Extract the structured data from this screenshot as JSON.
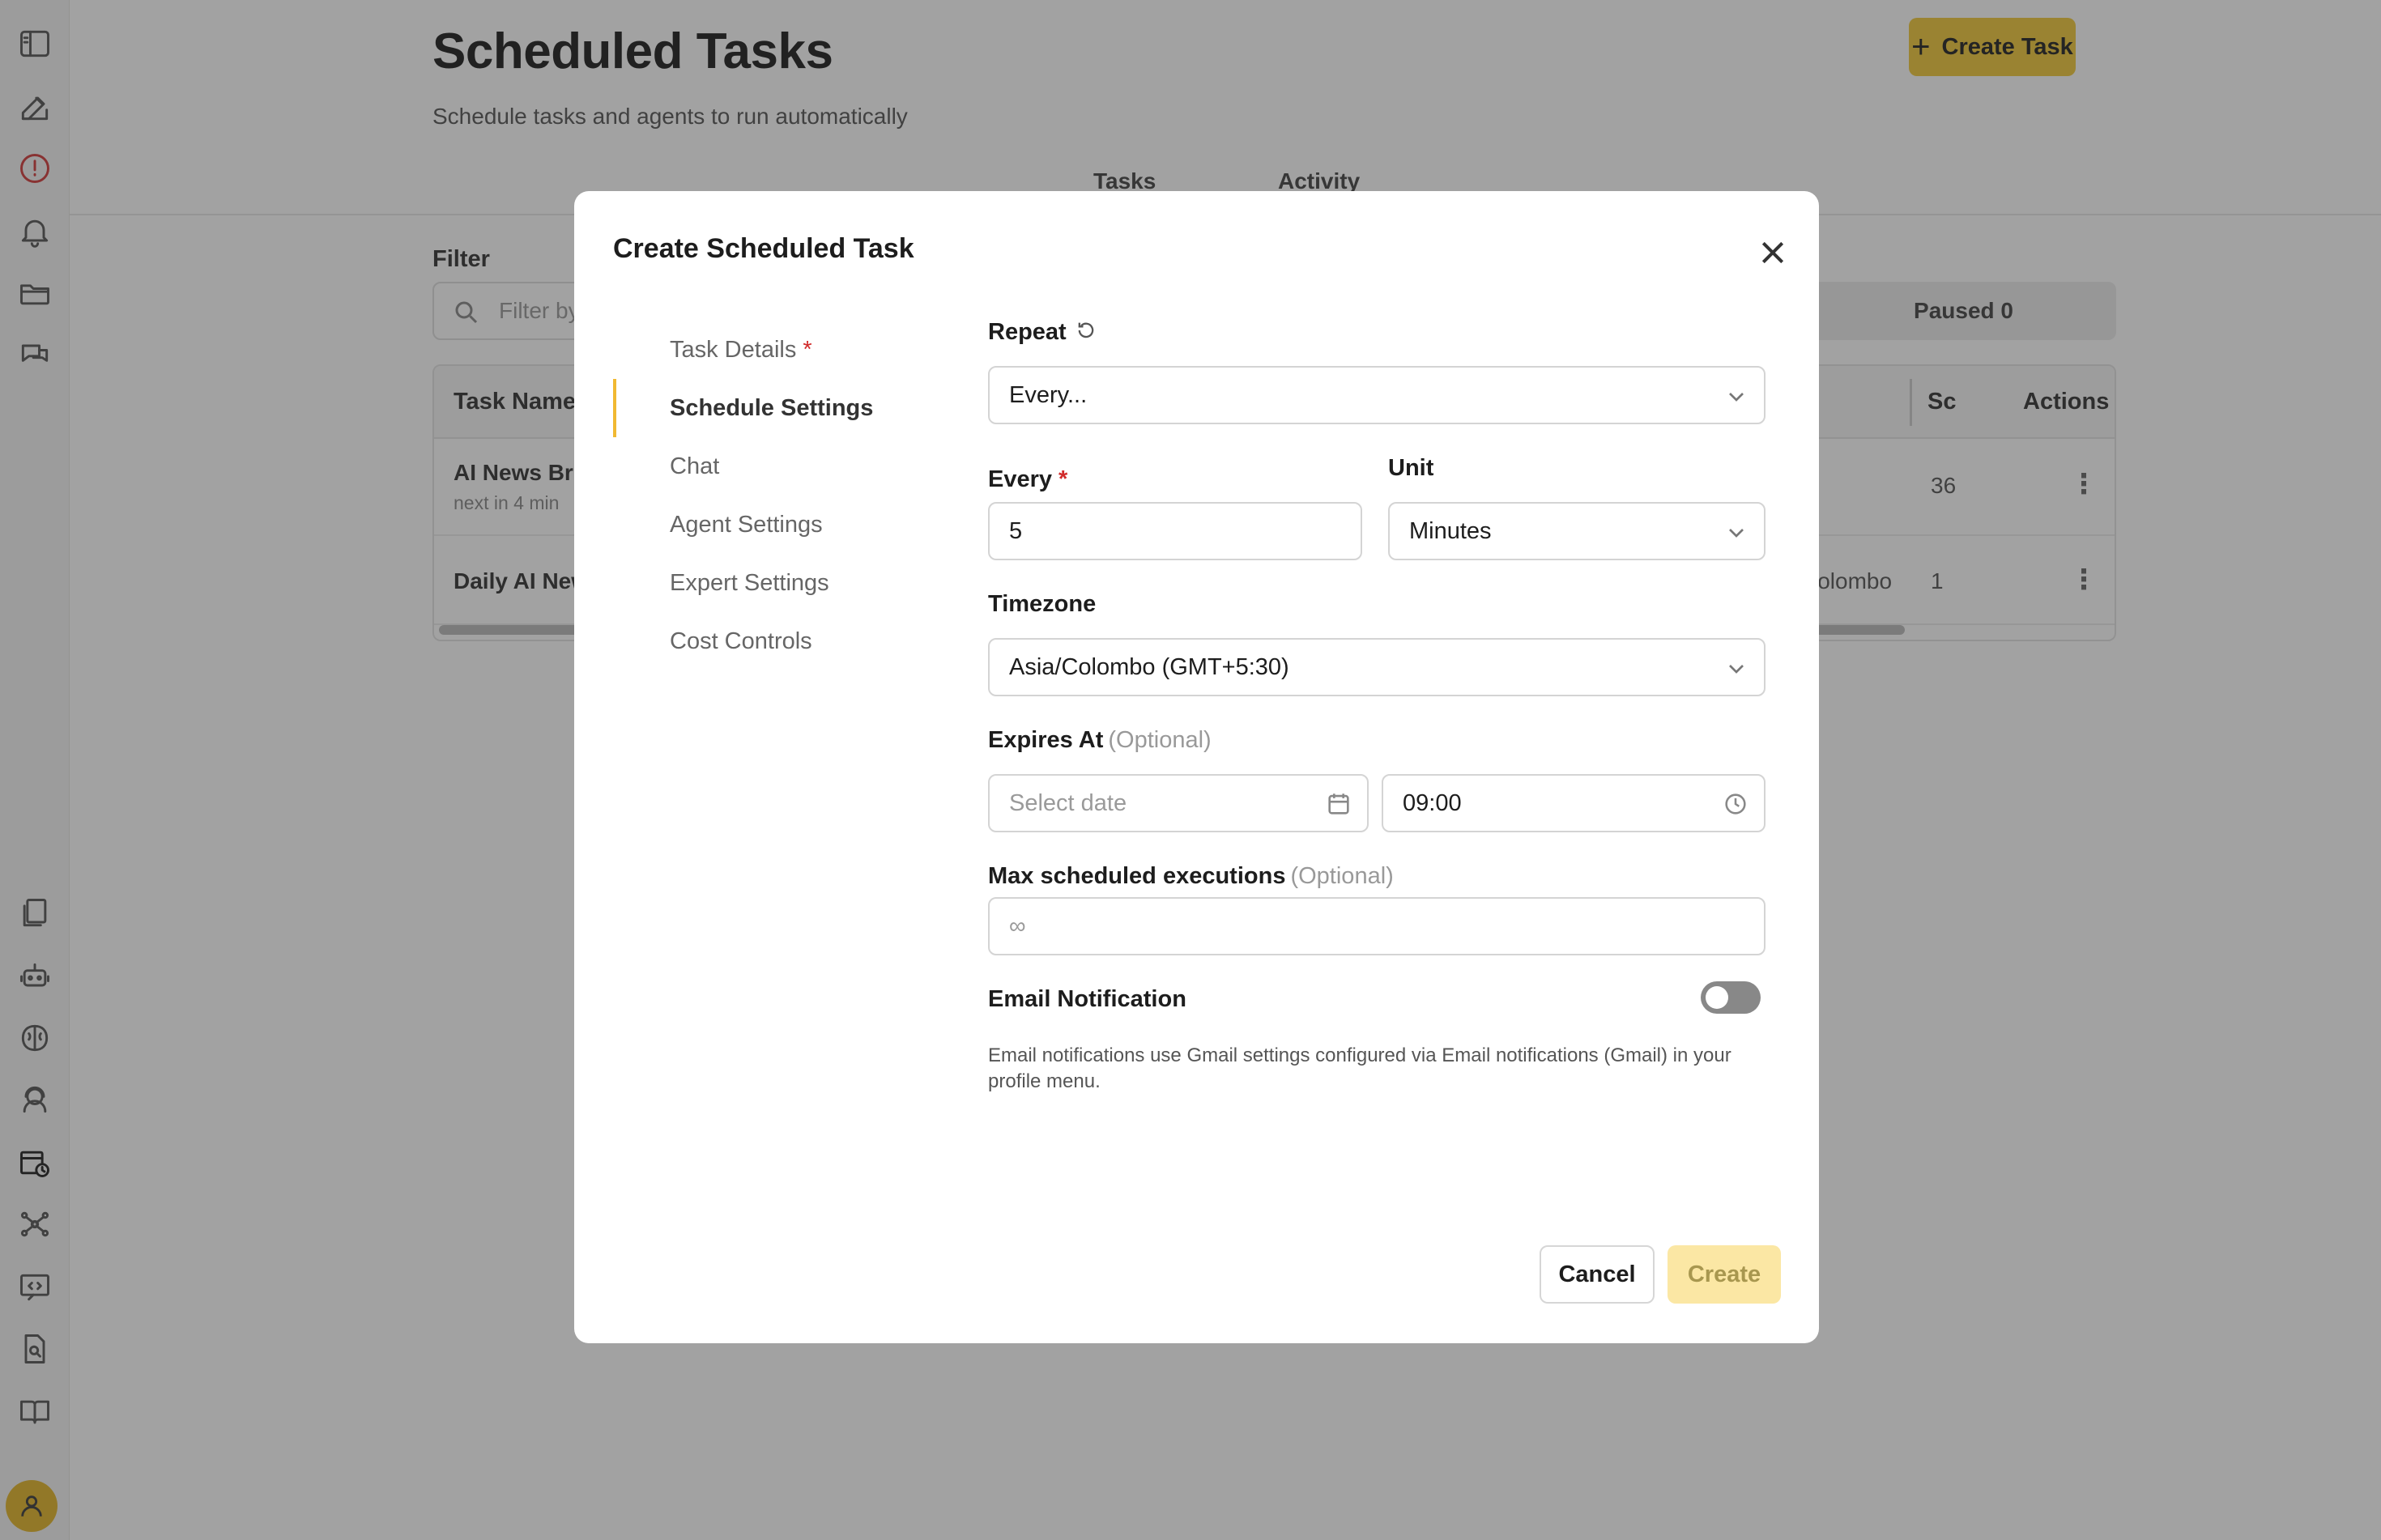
{
  "page": {
    "title": "Scheduled Tasks",
    "subtitle": "Schedule tasks and agents to run automatically",
    "create_button": "Create Task",
    "tabs": [
      "Tasks",
      "Activity"
    ],
    "filter_label": "Filter",
    "filter_placeholder": "Filter by",
    "status_pill": "Paused 0",
    "table": {
      "headers": {
        "name": "Task Name",
        "sc": "Sc",
        "actions": "Actions"
      },
      "rows": [
        {
          "name": "AI News Bri",
          "sub": "next in 4 min",
          "zone": "",
          "sc": "36"
        },
        {
          "name": "Daily AI New",
          "sub": "",
          "zone": "Colombo",
          "sc": "1"
        }
      ]
    }
  },
  "modal": {
    "title": "Create Scheduled Task",
    "steps": [
      {
        "label": "Task Details",
        "required": true
      },
      {
        "label": "Schedule Settings",
        "required": false
      },
      {
        "label": "Chat",
        "required": false
      },
      {
        "label": "Agent Settings",
        "required": false
      },
      {
        "label": "Expert Settings",
        "required": false
      },
      {
        "label": "Cost Controls",
        "required": false
      }
    ],
    "active_step": "Schedule Settings",
    "form": {
      "repeat_label": "Repeat",
      "repeat_value": "Every...",
      "every_label": "Every",
      "every_value": "5",
      "unit_label": "Unit",
      "unit_value": "Minutes",
      "timezone_label": "Timezone",
      "timezone_value": "Asia/Colombo (GMT+5:30)",
      "expires_label": "Expires At",
      "optional_text": "(Optional)",
      "date_placeholder": "Select date",
      "time_value": "09:00",
      "max_exec_label": "Max scheduled executions",
      "max_exec_placeholder": "∞",
      "email_label": "Email Notification",
      "email_enabled": false,
      "email_help": "Email notifications use Gmail settings configured via Email notifications (Gmail) in your profile menu."
    },
    "cancel_label": "Cancel",
    "create_label": "Create"
  },
  "colors": {
    "accent": "#f1c93a",
    "required": "#d12b2b",
    "active_step_bar": "#f1b932",
    "alert_icon": "#d23b3b"
  },
  "rail_icons": [
    "sidebar-toggle-icon",
    "edit-icon",
    "alert-icon",
    "bell-icon",
    "folder-icon",
    "chat-icon",
    "documents-icon",
    "robot-icon",
    "brain-icon",
    "support-agent-icon",
    "calendar-clock-icon",
    "network-icon",
    "code-chat-icon",
    "file-search-icon",
    "book-icon",
    "user-icon"
  ]
}
